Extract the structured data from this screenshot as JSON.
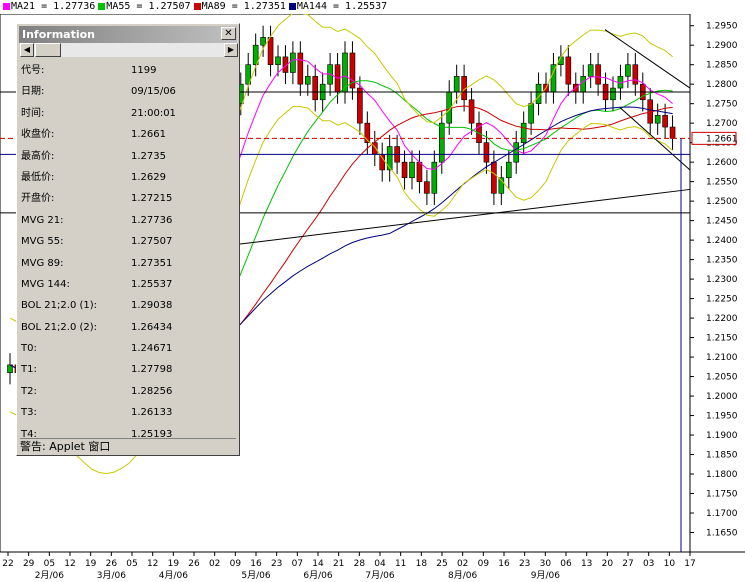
{
  "header": {
    "ma_items": [
      {
        "label": "MA21 = 1.27736",
        "color": "#ff00ff"
      },
      {
        "label": "MA55 = 1.27507",
        "color": "#00c000"
      },
      {
        "label": "MA89 = 1.27351",
        "color": "#cc0000"
      },
      {
        "label": "MA144 = 1.25537",
        "color": "#000080"
      }
    ]
  },
  "info_window": {
    "title": "Information",
    "close_symbol": "✕",
    "rows": [
      {
        "label": "代号:",
        "value": "1199"
      },
      {
        "label": "日期:",
        "value": "09/15/06"
      },
      {
        "label": "时间:",
        "value": "21:00:01"
      },
      {
        "label": "收盘价:",
        "value": "1.2661"
      },
      {
        "label": "最高价:",
        "value": "1.2735"
      },
      {
        "label": "最低价:",
        "value": "1.2629"
      },
      {
        "label": "开盘价:",
        "value": "1.27215"
      },
      {
        "label": "MVG 21:",
        "value": "1.27736"
      },
      {
        "label": "MVG 55:",
        "value": "1.27507"
      },
      {
        "label": "MVG 89:",
        "value": "1.27351"
      },
      {
        "label": "MVG 144:",
        "value": "1.25537"
      },
      {
        "label": "BOL 21;2.0 (1):",
        "value": "1.29038"
      },
      {
        "label": "BOL 21;2.0 (2):",
        "value": "1.26434"
      },
      {
        "label": "T0:",
        "value": "1.24671"
      },
      {
        "label": "T1:",
        "value": "1.27798"
      },
      {
        "label": "T2:",
        "value": "1.28256"
      },
      {
        "label": "T3:",
        "value": "1.26133"
      },
      {
        "label": "T4:",
        "value": "1.25193"
      }
    ],
    "warning": "警告: Applet 窗口"
  },
  "chart_data": {
    "type": "candlestick",
    "ylim": [
      1.16,
      1.298
    ],
    "y_ticks": [
      "1.2950",
      "1.2900",
      "1.2850",
      "1.2800",
      "1.2750",
      "1.2700",
      "1.2650",
      "1.2600",
      "1.2550",
      "1.2500",
      "1.2450",
      "1.2400",
      "1.2350",
      "1.2300",
      "1.2250",
      "1.2200",
      "1.2150",
      "1.2100",
      "1.2050",
      "1.2000",
      "1.1950",
      "1.1900",
      "1.1850",
      "1.1800",
      "1.1750",
      "1.1700",
      "1.1650"
    ],
    "current_price_label": "1.2661",
    "current_price": 1.2661,
    "x_day_ticks": [
      "22",
      "29",
      "05",
      "12",
      "19",
      "26",
      "05",
      "12",
      "19",
      "26",
      "02",
      "09",
      "16",
      "23",
      "07",
      "14",
      "21",
      "28",
      "04",
      "11",
      "18",
      "25",
      "02",
      "09",
      "16",
      "23",
      "30",
      "06",
      "13",
      "20",
      "27",
      "03",
      "10",
      "17"
    ],
    "x_month_labels": [
      "2月/06",
      "3月/06",
      "4月/06",
      "5月/06",
      "6月/06",
      "7月/06",
      "8月/06",
      "9月/06"
    ],
    "horizontal_levels": [
      1.278,
      1.2661,
      1.262,
      1.247
    ],
    "closes": [
      1.208,
      1.206,
      1.204,
      1.201,
      1.198,
      1.196,
      1.194,
      1.192,
      1.195,
      1.193,
      1.19,
      1.188,
      1.191,
      1.194,
      1.197,
      1.2,
      1.205,
      1.21,
      1.212,
      1.214,
      1.22,
      1.225,
      1.23,
      1.235,
      1.24,
      1.25,
      1.255,
      1.26,
      1.265,
      1.27,
      1.275,
      1.28,
      1.285,
      1.29,
      1.292,
      1.285,
      1.287,
      1.283,
      1.288,
      1.28,
      1.282,
      1.276,
      1.28,
      1.285,
      1.278,
      1.288,
      1.279,
      1.27,
      1.265,
      1.262,
      1.258,
      1.264,
      1.26,
      1.256,
      1.26,
      1.255,
      1.252,
      1.26,
      1.27,
      1.278,
      1.282,
      1.276,
      1.27,
      1.265,
      1.26,
      1.252,
      1.256,
      1.26,
      1.265,
      1.27,
      1.275,
      1.28,
      1.278,
      1.285,
      1.287,
      1.28,
      1.278,
      1.282,
      1.285,
      1.28,
      1.276,
      1.279,
      1.282,
      1.285,
      1.28,
      1.276,
      1.27,
      1.272,
      1.269,
      1.2661
    ]
  }
}
